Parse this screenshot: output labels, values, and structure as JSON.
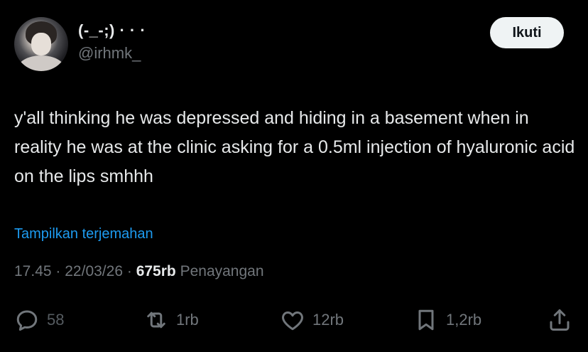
{
  "author": {
    "display_name": "(-_-;) · · ·",
    "handle": "@irhmk_"
  },
  "follow_label": "Ikuti",
  "tweet": {
    "text": "y'all thinking he was depressed and hiding in a basement when in reality he was at the clinic asking for a 0.5ml injection of hyaluronic acid on the lips smhhh"
  },
  "translate_label": "Tampilkan terjemahan",
  "meta": {
    "time": "17.45",
    "date": "22/03/26",
    "views": "675rb",
    "views_label": "Penayangan",
    "sep": "·"
  },
  "actions": {
    "replies": "58",
    "reposts": "1rb",
    "likes": "12rb",
    "bookmarks": "1,2rb"
  },
  "icons": {
    "reply": "reply-icon",
    "repost": "repost-icon",
    "like": "heart-icon",
    "bookmark": "bookmark-icon",
    "share": "share-icon"
  }
}
